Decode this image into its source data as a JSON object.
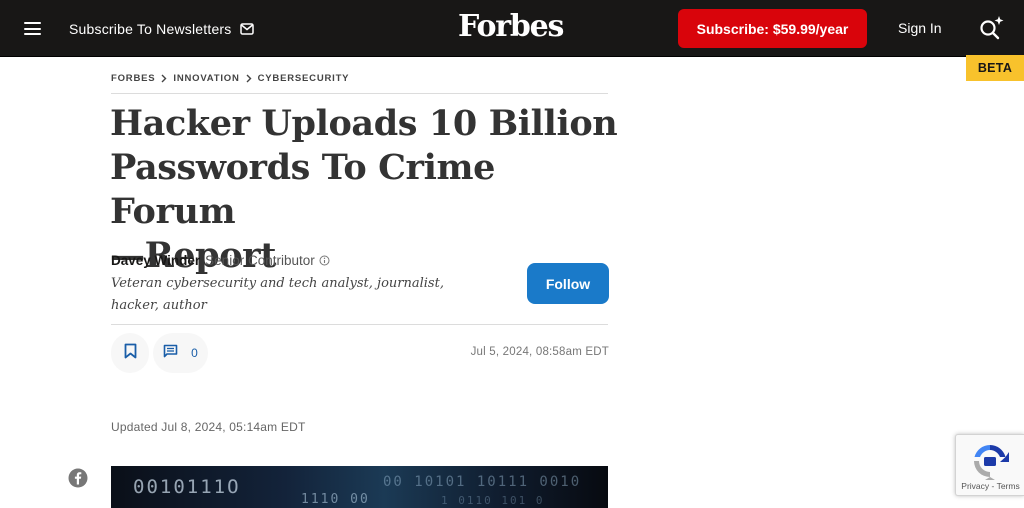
{
  "header": {
    "newsletter_label": "Subscribe To Newsletters",
    "logo_text": "Forbes",
    "subscribe_label": "Subscribe: $59.99/year",
    "signin_label": "Sign In",
    "beta_label": "BETA"
  },
  "breadcrumb": [
    "FORBES",
    "INNOVATION",
    "CYBERSECURITY"
  ],
  "article": {
    "headline_lines": [
      "Hacker Uploads 10 Billion",
      "Passwords To Crime Forum",
      "—Report"
    ],
    "author_name": "Davey Winder",
    "author_role": "Senior Contributor",
    "author_bio_lines": [
      "Veteran cybersecurity and tech analyst, journalist,",
      "hacker, author"
    ],
    "follow_label": "Follow",
    "comment_count": "0",
    "published": "Jul 5, 2024, 08:58am EDT",
    "updated": "Updated Jul 8, 2024, 05:14am EDT",
    "hero_code": [
      "0010111O",
      "1110 00",
      "00 10101 10111 0010",
      "1 0110 101 0"
    ]
  },
  "recaptcha": {
    "links": "Privacy - Terms"
  },
  "colors": {
    "topbar": "#181716",
    "subscribe": "#d9040b",
    "follow": "#1a7ac9",
    "beta": "#f8c22c"
  },
  "icons": [
    "menu-icon",
    "mail-icon",
    "search-sparkle-icon",
    "chevron-right-icon",
    "info-icon",
    "bookmark-icon",
    "comment-icon",
    "facebook-icon",
    "recaptcha-icon"
  ]
}
